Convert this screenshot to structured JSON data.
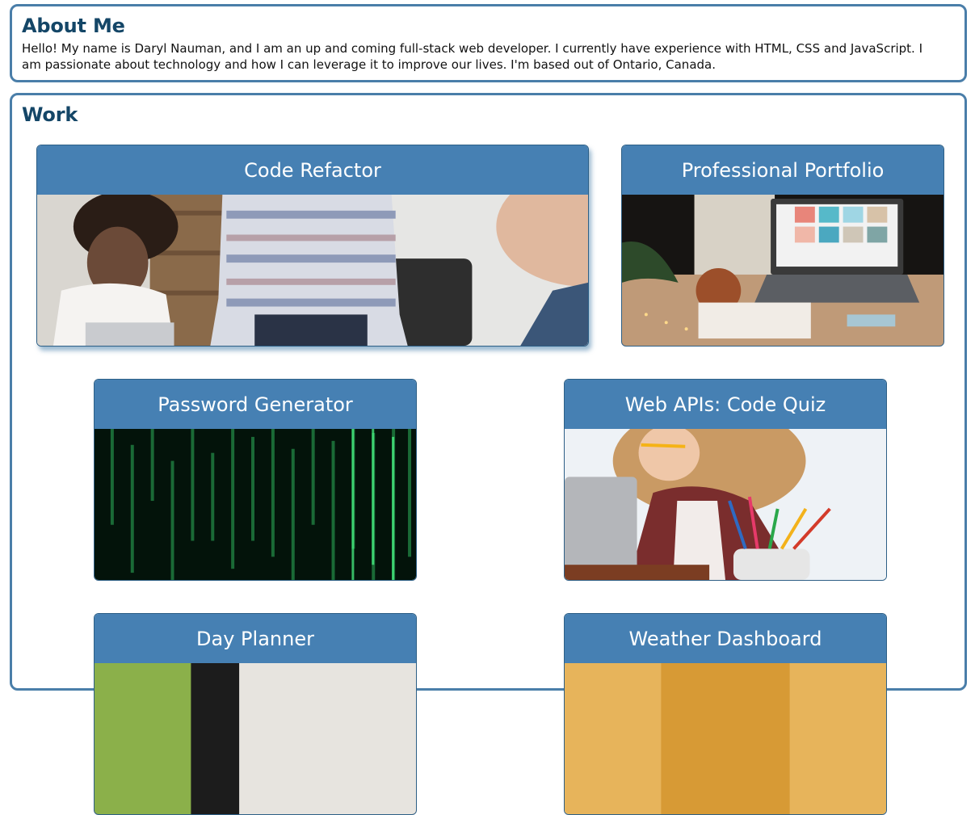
{
  "about": {
    "heading": "About Me",
    "text": "Hello! My name is Daryl Nauman, and I am an up and coming full-stack web developer. I currently have experience with HTML, CSS and JavaScript. I am passionate about technology and how I can leverage it to improve our lives. I'm based out of Ontario, Canada."
  },
  "work": {
    "heading": "Work",
    "projects": [
      {
        "title": "Code Refactor",
        "image": "office-meeting-photo"
      },
      {
        "title": "Professional Portfolio",
        "image": "laptop-desk-photo"
      },
      {
        "title": "Password Generator",
        "image": "green-code-matrix-photo"
      },
      {
        "title": "Web APIs: Code Quiz",
        "image": "student-with-pencil-photo"
      },
      {
        "title": "Day Planner",
        "image": "planner-photo"
      },
      {
        "title": "Weather Dashboard",
        "image": "weather-photo"
      }
    ]
  },
  "colors": {
    "border": "#4a7ea9",
    "heading": "#144667",
    "card_header": "#4680b3"
  }
}
